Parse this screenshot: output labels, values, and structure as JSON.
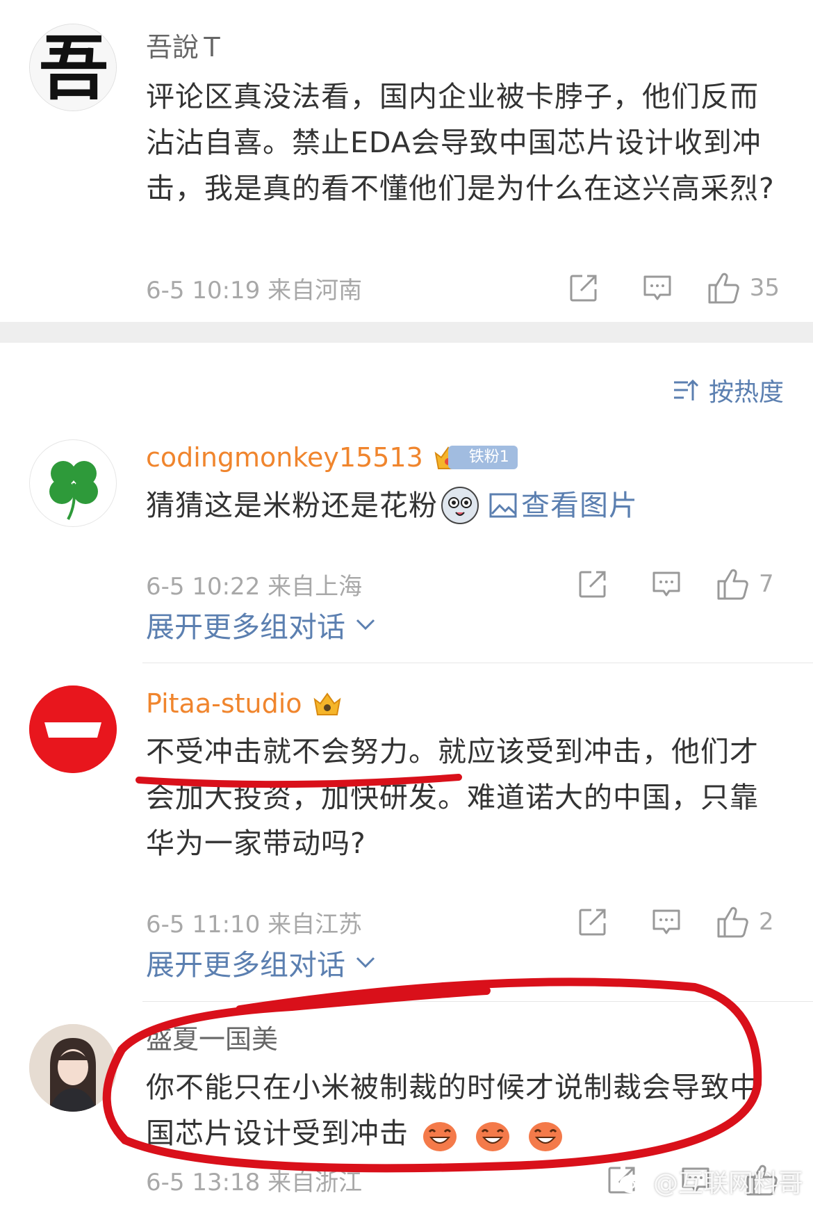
{
  "comments": [
    {
      "username": "吾說Ｔ",
      "text": "评论区真没法看，国内企业被卡脖子，他们反而沾沾自喜。禁止EDA会导致中国芯片设计收到冲击，我是真的看不懂他们是为什么在这兴高采烈?",
      "time": "6-5 10:19",
      "location": "来自河南",
      "likes": "35",
      "avatar_glyph": "吾"
    },
    {
      "username": "codingmonkey15513",
      "badge": "铁粉1",
      "text": "猜猜这是米粉还是花粉",
      "view_image": "查看图片",
      "time": "6-5 10:22",
      "location": "来自上海",
      "likes": "7",
      "expand": "展开更多组对话"
    },
    {
      "username": "Pitaa-studio",
      "text": "不受冲击就不会努力。就应该受到冲击，他们才会加大投资，加快研发。难道诺大的中国，只靠华为一家带动吗?",
      "time": "6-5 11:10",
      "location": "来自江苏",
      "likes": "2",
      "expand": "展开更多组对话"
    },
    {
      "username": "盛夏一国美",
      "text": "你不能只在小米被制裁的时候才说制裁会导致中国芯片设计受到冲击",
      "time": "6-5 13:18",
      "location": "来自浙江"
    }
  ],
  "sort": {
    "label": "按热度"
  },
  "watermark": "@互联网料哥",
  "colors": {
    "link": "#5b7fb0",
    "orange_name": "#f0852d",
    "red_annotation": "#d9101a"
  }
}
